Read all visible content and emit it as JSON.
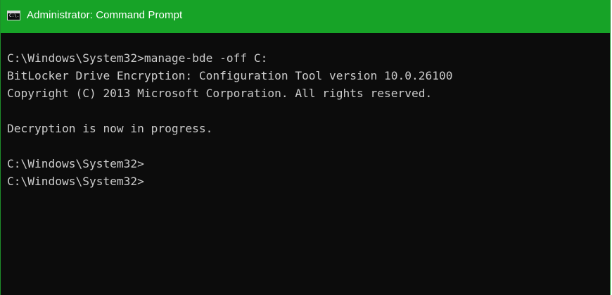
{
  "window": {
    "title": "Administrator: Command Prompt",
    "icon": "cmd-icon",
    "icon_glyph": "C:\\.",
    "accent_color": "#17a327",
    "console_background": "#0c0c0c",
    "console_text_color": "#cccccc"
  },
  "console": {
    "lines": [
      "C:\\Windows\\System32>manage-bde -off C:",
      "BitLocker Drive Encryption: Configuration Tool version 10.0.26100",
      "Copyright (C) 2013 Microsoft Corporation. All rights reserved.",
      "",
      "Decryption is now in progress.",
      "",
      "C:\\Windows\\System32>",
      "C:\\Windows\\System32>"
    ]
  }
}
